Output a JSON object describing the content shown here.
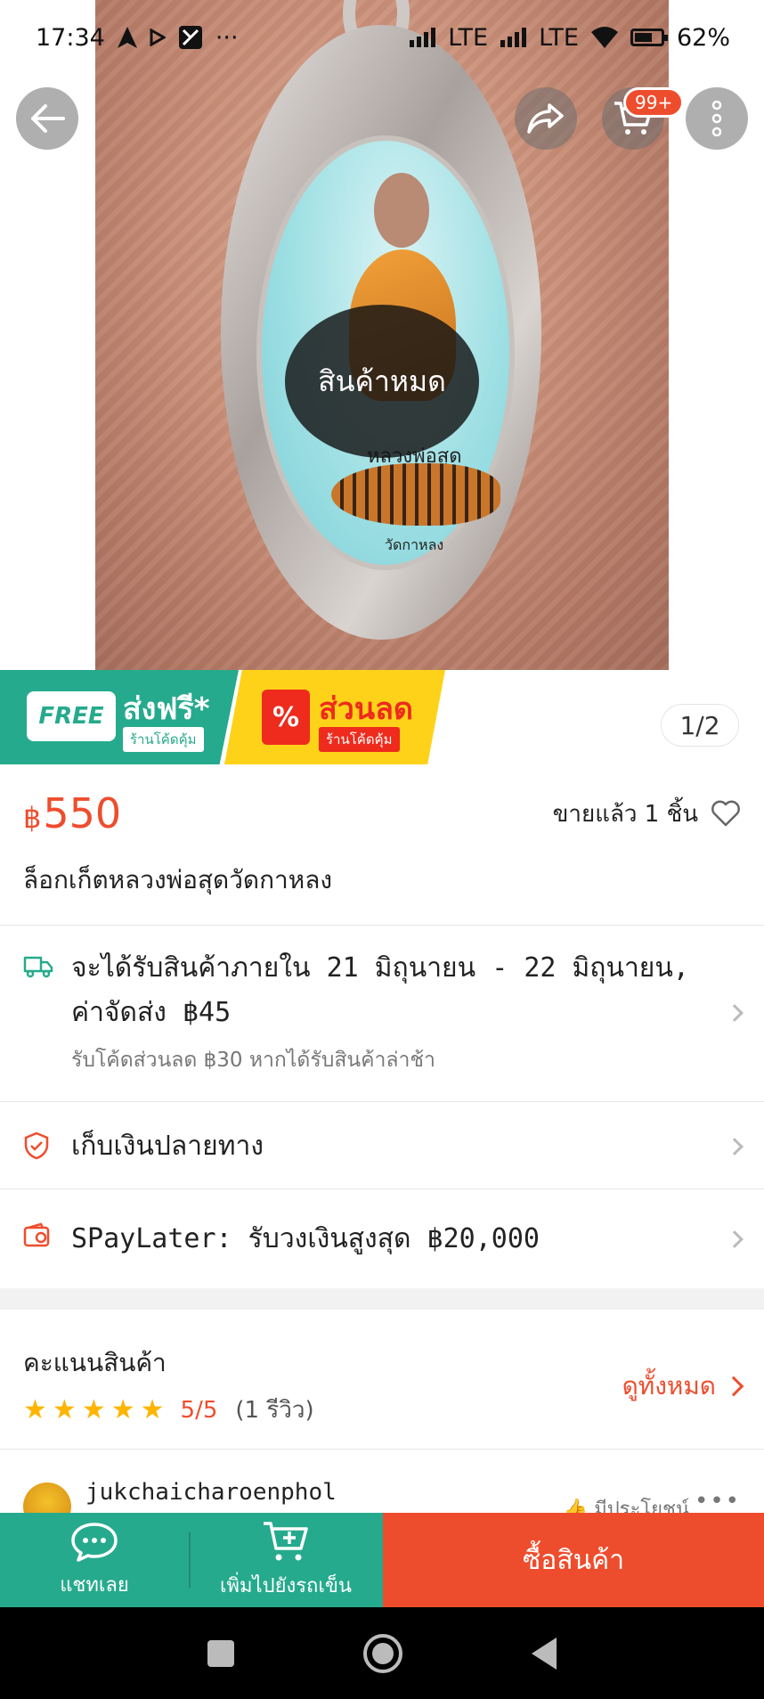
{
  "status_bar": {
    "time": "17:34",
    "network1": "LTE",
    "network2": "LTE",
    "battery": "62%"
  },
  "hero": {
    "pendant_text": "หลวงพ่อสุด",
    "pendant_text2": "วัดกาหลง",
    "overlay_label": "สินค้าหมด",
    "cart_badge": "99+",
    "page_indicator": "1/2"
  },
  "promo": {
    "free_tag": "FREE",
    "free_title": "ส่งฟรี*",
    "free_sub": "ร้านโค้ดคุ้ม",
    "discount_icon": "%",
    "discount_title": "ส่วนลด",
    "discount_sub": "ร้านโค้ดคุ้ม"
  },
  "product": {
    "currency": "฿",
    "price": "550",
    "sold": "ขายแล้ว 1 ชิ้น",
    "title": "ล็อกเก็ตหลวงพ่อสุดวัดกาหลง"
  },
  "shipping": {
    "line1": "จะได้รับสินค้าภายใน 21 มิถุนายน - 22 มิถุนายน,",
    "line2": "ค่าจัดส่ง ฿45",
    "sub": "รับโค้ดส่วนลด ฿30 หากได้รับสินค้าล่าช้า"
  },
  "cod": {
    "label": "เก็บเงินปลายทาง"
  },
  "spaylater": {
    "label": "SPayLater: รับวงเงินสูงสุด ฿20,000"
  },
  "ratings": {
    "title": "คะแนนสินค้า",
    "score": "5/5",
    "count": "(1 รีวิว)",
    "see_all": "ดูทั้งหมด"
  },
  "review": {
    "username": "jukchaicharoenphol",
    "helpful": "มีประโยชน์",
    "more": "•••"
  },
  "action_bar": {
    "chat": "แชทเลย",
    "add_cart": "เพิ่มไปยังรถเข็น",
    "buy": "ซื้อสินค้า"
  },
  "colors": {
    "accent": "#ee4d2d",
    "green": "#26aa8d",
    "star": "#ffb400"
  }
}
